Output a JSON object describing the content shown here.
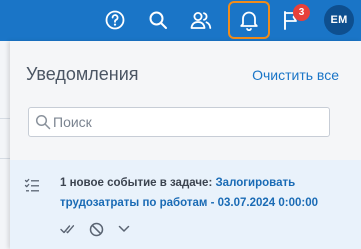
{
  "topbar": {
    "icons": [
      "help-icon",
      "search-icon",
      "users-icon",
      "bell-icon",
      "flag-icon"
    ],
    "notification_count": "3",
    "avatar_initials": "EM",
    "colors": {
      "bar": "#1a75c7",
      "highlight": "#f08c1a",
      "badge": "#e8403a"
    }
  },
  "panel": {
    "title": "Уведомления",
    "clear_label": "Очистить все",
    "search": {
      "placeholder": "Поиск",
      "value": ""
    }
  },
  "notification": {
    "prefix": "1 новое событие в задаче: ",
    "task_link": "Залогировать трудозатраты по работам - 03.07.2024 0:00:00",
    "actions": [
      "check-double-icon",
      "ban-icon",
      "chevron-down-icon"
    ]
  }
}
